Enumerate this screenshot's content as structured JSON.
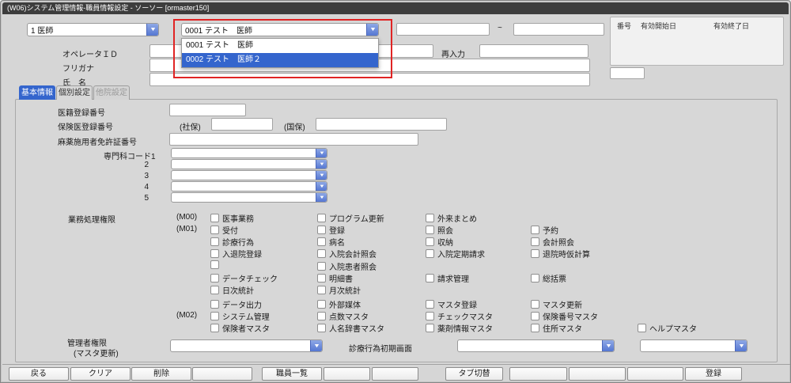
{
  "window": {
    "title": "(W06)システム管理情報-職員情報設定 - ソーソー [ormaster150]"
  },
  "header": {
    "category_select": {
      "value": "1 医師"
    },
    "staff_combo": {
      "value": "0001 テスト　医師",
      "options": [
        {
          "label": "0001 テスト　医師",
          "selected": false
        },
        {
          "label": "0002 テスト　医師２",
          "selected": true
        }
      ]
    },
    "valid_from": {
      "value": ""
    },
    "range_separator": "~",
    "valid_to": {
      "value": ""
    },
    "validity_table": {
      "columns": [
        "番号",
        "有効開始日",
        "有効終了日"
      ],
      "rows": []
    },
    "number_field": {
      "value": ""
    },
    "operator_id": {
      "label": "オペレータＩＤ",
      "value": ""
    },
    "reenter": {
      "label": "再入力",
      "value": ""
    },
    "furigana": {
      "label": "フリガナ",
      "value": ""
    },
    "name": {
      "label": "氏　名",
      "value": ""
    }
  },
  "tabs": [
    {
      "label": "基本情報",
      "state": "active"
    },
    {
      "label": "個別設定",
      "state": "normal"
    },
    {
      "label": "他院設定",
      "state": "disabled"
    }
  ],
  "basic_info": {
    "doctor_registration": {
      "label": "医籍登録番号",
      "value": ""
    },
    "insurance_doctor": {
      "label": "保険医登録番号",
      "shaho_label": "(社保)",
      "shaho_value": "",
      "kokuho_label": "(国保)",
      "kokuho_value": ""
    },
    "narcotics_license": {
      "label": "麻薬施用者免許証番号",
      "value": ""
    },
    "specialty": {
      "label": "専門科コード1",
      "rows": [
        {
          "no": "1",
          "value": ""
        },
        {
          "no": "2",
          "value": ""
        },
        {
          "no": "3",
          "value": ""
        },
        {
          "no": "4",
          "value": ""
        },
        {
          "no": "5",
          "value": ""
        }
      ]
    },
    "permissions": {
      "label": "業務処理権限",
      "rows": [
        {
          "group": "(M00)",
          "cells": [
            {
              "col": 1,
              "label": "医事業務",
              "checked": false
            },
            {
              "col": 2,
              "label": "プログラム更新",
              "checked": false
            },
            {
              "col": 3,
              "label": "外来まとめ",
              "checked": false
            }
          ]
        },
        {
          "group": "(M01)",
          "cells": [
            {
              "col": 1,
              "label": "受付",
              "checked": false
            },
            {
              "col": 2,
              "label": "登録",
              "checked": false
            },
            {
              "col": 3,
              "label": "照会",
              "checked": false
            },
            {
              "col": 4,
              "label": "予約",
              "checked": false
            }
          ]
        },
        {
          "cells": [
            {
              "col": 1,
              "label": "診療行為",
              "checked": false
            },
            {
              "col": 2,
              "label": "病名",
              "checked": false
            },
            {
              "col": 3,
              "label": "収納",
              "checked": false
            },
            {
              "col": 4,
              "label": "会計照会",
              "checked": false
            }
          ]
        },
        {
          "cells": [
            {
              "col": 1,
              "label": "入退院登録",
              "checked": false
            },
            {
              "col": 2,
              "label": "入院会計照会",
              "checked": false
            },
            {
              "col": 3,
              "label": "入院定期請求",
              "checked": false
            },
            {
              "col": 4,
              "label": "退院時仮計算",
              "checked": false
            }
          ]
        },
        {
          "cells": [
            {
              "col": 1,
              "label": "",
              "checked": false
            },
            {
              "col": 2,
              "label": "入院患者照会",
              "checked": false
            }
          ]
        },
        {
          "cells": [
            {
              "col": 1,
              "label": "データチェック",
              "checked": false
            },
            {
              "col": 2,
              "label": "明細書",
              "checked": false
            },
            {
              "col": 3,
              "label": "請求管理",
              "checked": false
            },
            {
              "col": 4,
              "label": "総括票",
              "checked": false
            }
          ]
        },
        {
          "cells": [
            {
              "col": 1,
              "label": "日次統計",
              "checked": false
            },
            {
              "col": 2,
              "label": "月次統計",
              "checked": false
            }
          ]
        },
        {
          "cells": [
            {
              "col": 1,
              "label": "データ出力",
              "checked": false
            },
            {
              "col": 2,
              "label": "外部媒体",
              "checked": false
            },
            {
              "col": 3,
              "label": "マスタ登録",
              "checked": false
            },
            {
              "col": 4,
              "label": "マスタ更新",
              "checked": false
            }
          ]
        },
        {
          "group": "(M02)",
          "cells": [
            {
              "col": 1,
              "label": "システム管理",
              "checked": false
            },
            {
              "col": 2,
              "label": "点数マスタ",
              "checked": false
            },
            {
              "col": 3,
              "label": "チェックマスタ",
              "checked": false
            },
            {
              "col": 4,
              "label": "保険番号マスタ",
              "checked": false
            }
          ]
        },
        {
          "cells": [
            {
              "col": 1,
              "label": "保険者マスタ",
              "checked": false
            },
            {
              "col": 2,
              "label": "人名辞書マスタ",
              "checked": false
            },
            {
              "col": 3,
              "label": "薬剤情報マスタ",
              "checked": false
            },
            {
              "col": 4,
              "label": "住所マスタ",
              "checked": false
            },
            {
              "col": 5,
              "label": "ヘルプマスタ",
              "checked": false
            }
          ]
        }
      ]
    },
    "admin_permission": {
      "label_line1": "管理者権限",
      "label_line2": "(マスタ更新)",
      "value": ""
    },
    "initial_screen": {
      "label": "診療行為初期画面",
      "value": ""
    },
    "sub_select": {
      "value": ""
    }
  },
  "footer": {
    "buttons": [
      {
        "label": "戻る"
      },
      {
        "label": "クリア"
      },
      {
        "label": "削除"
      },
      {
        "label": ""
      },
      {
        "label": "職員一覧"
      },
      {
        "label": ""
      },
      {
        "label": ""
      },
      {
        "label": "タブ切替"
      },
      {
        "label": ""
      },
      {
        "label": ""
      },
      {
        "label": ""
      },
      {
        "label": "登録"
      }
    ]
  },
  "colors": {
    "accent_blue": "#3465cd",
    "highlight_red": "#e02424",
    "titlebar": "#3d3d3d"
  }
}
